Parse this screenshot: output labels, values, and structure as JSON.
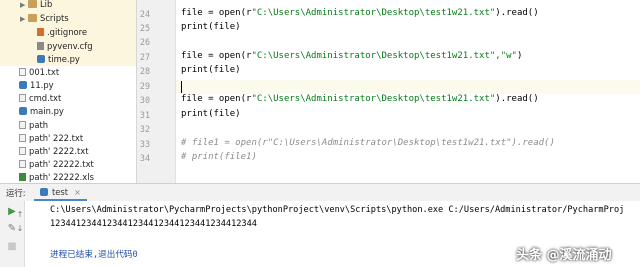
{
  "project_tree": {
    "items": [
      {
        "label": "Lib",
        "kind": "folder",
        "expandable": true
      },
      {
        "label": "Scripts",
        "kind": "folder",
        "expandable": true
      },
      {
        "label": ".gitignore",
        "kind": "git"
      },
      {
        "label": "pyvenv.cfg",
        "kind": "cfg"
      },
      {
        "label": "time.py",
        "kind": "py"
      },
      {
        "label": "001.txt",
        "kind": "txt"
      },
      {
        "label": "11.py",
        "kind": "py"
      },
      {
        "label": "cmd.txt",
        "kind": "txt"
      },
      {
        "label": "main.py",
        "kind": "py"
      },
      {
        "label": "path",
        "kind": "txt"
      },
      {
        "label": "path' 222.txt",
        "kind": "txt"
      },
      {
        "label": "path' 2222.txt",
        "kind": "txt"
      },
      {
        "label": "path' 22222.txt",
        "kind": "txt"
      },
      {
        "label": "path' 22222.xls",
        "kind": "xls"
      }
    ]
  },
  "editor": {
    "line_numbers": [
      "24",
      "25",
      "26",
      "27",
      "28",
      "29",
      "30",
      "31",
      "32",
      "33",
      "34"
    ],
    "lines": [
      {
        "a": "file = open(r",
        "s": "\"C:\\Users\\Administrator\\Desktop\\test1w21.txt\"",
        "b": ").read()"
      },
      {
        "a": "print(file)"
      },
      {
        "a": ""
      },
      {
        "a": "file = open(r",
        "s": "\"C:\\Users\\Administrator\\Desktop\\test1w21.txt\",\"w\"",
        "b": ")"
      },
      {
        "a": "print(file)"
      },
      {
        "a": ""
      },
      {
        "a": "file = open(r",
        "s": "\"C:\\Users\\Administrator\\Desktop\\test1w21.txt\"",
        "b": ").read()"
      },
      {
        "a": "print(file)"
      },
      {
        "a": ""
      },
      {
        "c": "# file1 = open(r\"C:\\Users\\Administrator\\Desktop\\test1w21.txt\").read()"
      },
      {
        "c": "# print(file1)"
      }
    ]
  },
  "run_panel": {
    "label": "运行:",
    "tab_label": "test",
    "command": "C:\\Users\\Administrator\\PycharmProjects\\pythonProject\\venv\\Scripts\\python.exe C:/Users/Administrator/PycharmProj",
    "output": "1234412344123441234412344123441234412344",
    "exit_message": "进程已结束,退出代码0"
  },
  "watermark": "头条 @溪流涌动",
  "colors": {
    "string": "#067d17",
    "comment": "#8c8c8c",
    "exit_message": "#2250b0",
    "venv_highlight": "#fbf6dd"
  }
}
